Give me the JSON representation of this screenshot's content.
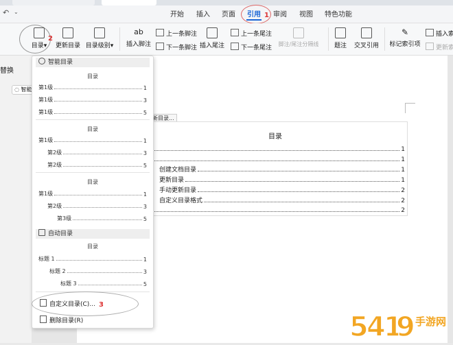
{
  "menu": {
    "items": [
      "开始",
      "插入",
      "页面",
      "引用",
      "审阅",
      "视图",
      "特色功能"
    ],
    "active": "引用"
  },
  "ribbon": {
    "toc": "目录",
    "update_toc": "更新目录",
    "toc_level": "目录级别",
    "insert_footnote": "插入脚注",
    "prev_footnote": "上一条脚注",
    "next_footnote": "下一条脚注",
    "insert_endnote": "插入尾注",
    "prev_endnote": "上一条尾注",
    "next_endnote": "下一条尾注",
    "separator_line": "脚注/尾注分隔线",
    "caption": "题注",
    "cross_ref": "交叉引用",
    "mark_index": "标记索引项",
    "insert_idx": "插入索",
    "update_idx": "更新索"
  },
  "annotations": {
    "n1": "1",
    "n2": "2",
    "n3": "3"
  },
  "left_panel": {
    "title": "替换",
    "smart": "智能"
  },
  "dropdown": {
    "smart_section": "智能目录",
    "auto_section": "自动目录",
    "preview_title": "目录",
    "preview1": [
      {
        "label": "第1级",
        "page": "1"
      },
      {
        "label": "第1级",
        "page": "3"
      },
      {
        "label": "第1级",
        "page": "5"
      }
    ],
    "preview2": [
      {
        "label": "第1级",
        "page": "1"
      },
      {
        "label": "第2级",
        "page": "3"
      },
      {
        "label": "第2级",
        "page": "5"
      }
    ],
    "preview3": [
      {
        "label": "第1级",
        "page": "1"
      },
      {
        "label": "第2级",
        "page": "3"
      },
      {
        "label": "第3级",
        "page": "5"
      }
    ],
    "preview_auto": [
      {
        "label": "标题 1",
        "page": "1"
      },
      {
        "label": "标题 2",
        "page": "3"
      },
      {
        "label": "标题 3",
        "page": "5"
      }
    ],
    "custom": "自定义目录(C)...",
    "delete": "删除目录(R)"
  },
  "document": {
    "update_tab": "新目录...",
    "toc_title": "目录",
    "lines": [
      {
        "label": "",
        "page": "1"
      },
      {
        "label": "",
        "page": "1"
      },
      {
        "label": "创建文档目录",
        "page": "1"
      },
      {
        "label": "更新目录",
        "page": "1"
      },
      {
        "label": "手动更新目录",
        "page": "2"
      },
      {
        "label": "自定义目录格式",
        "page": "2"
      },
      {
        "label": "",
        "page": "2"
      }
    ]
  },
  "watermark": {
    "text": "手游网"
  }
}
